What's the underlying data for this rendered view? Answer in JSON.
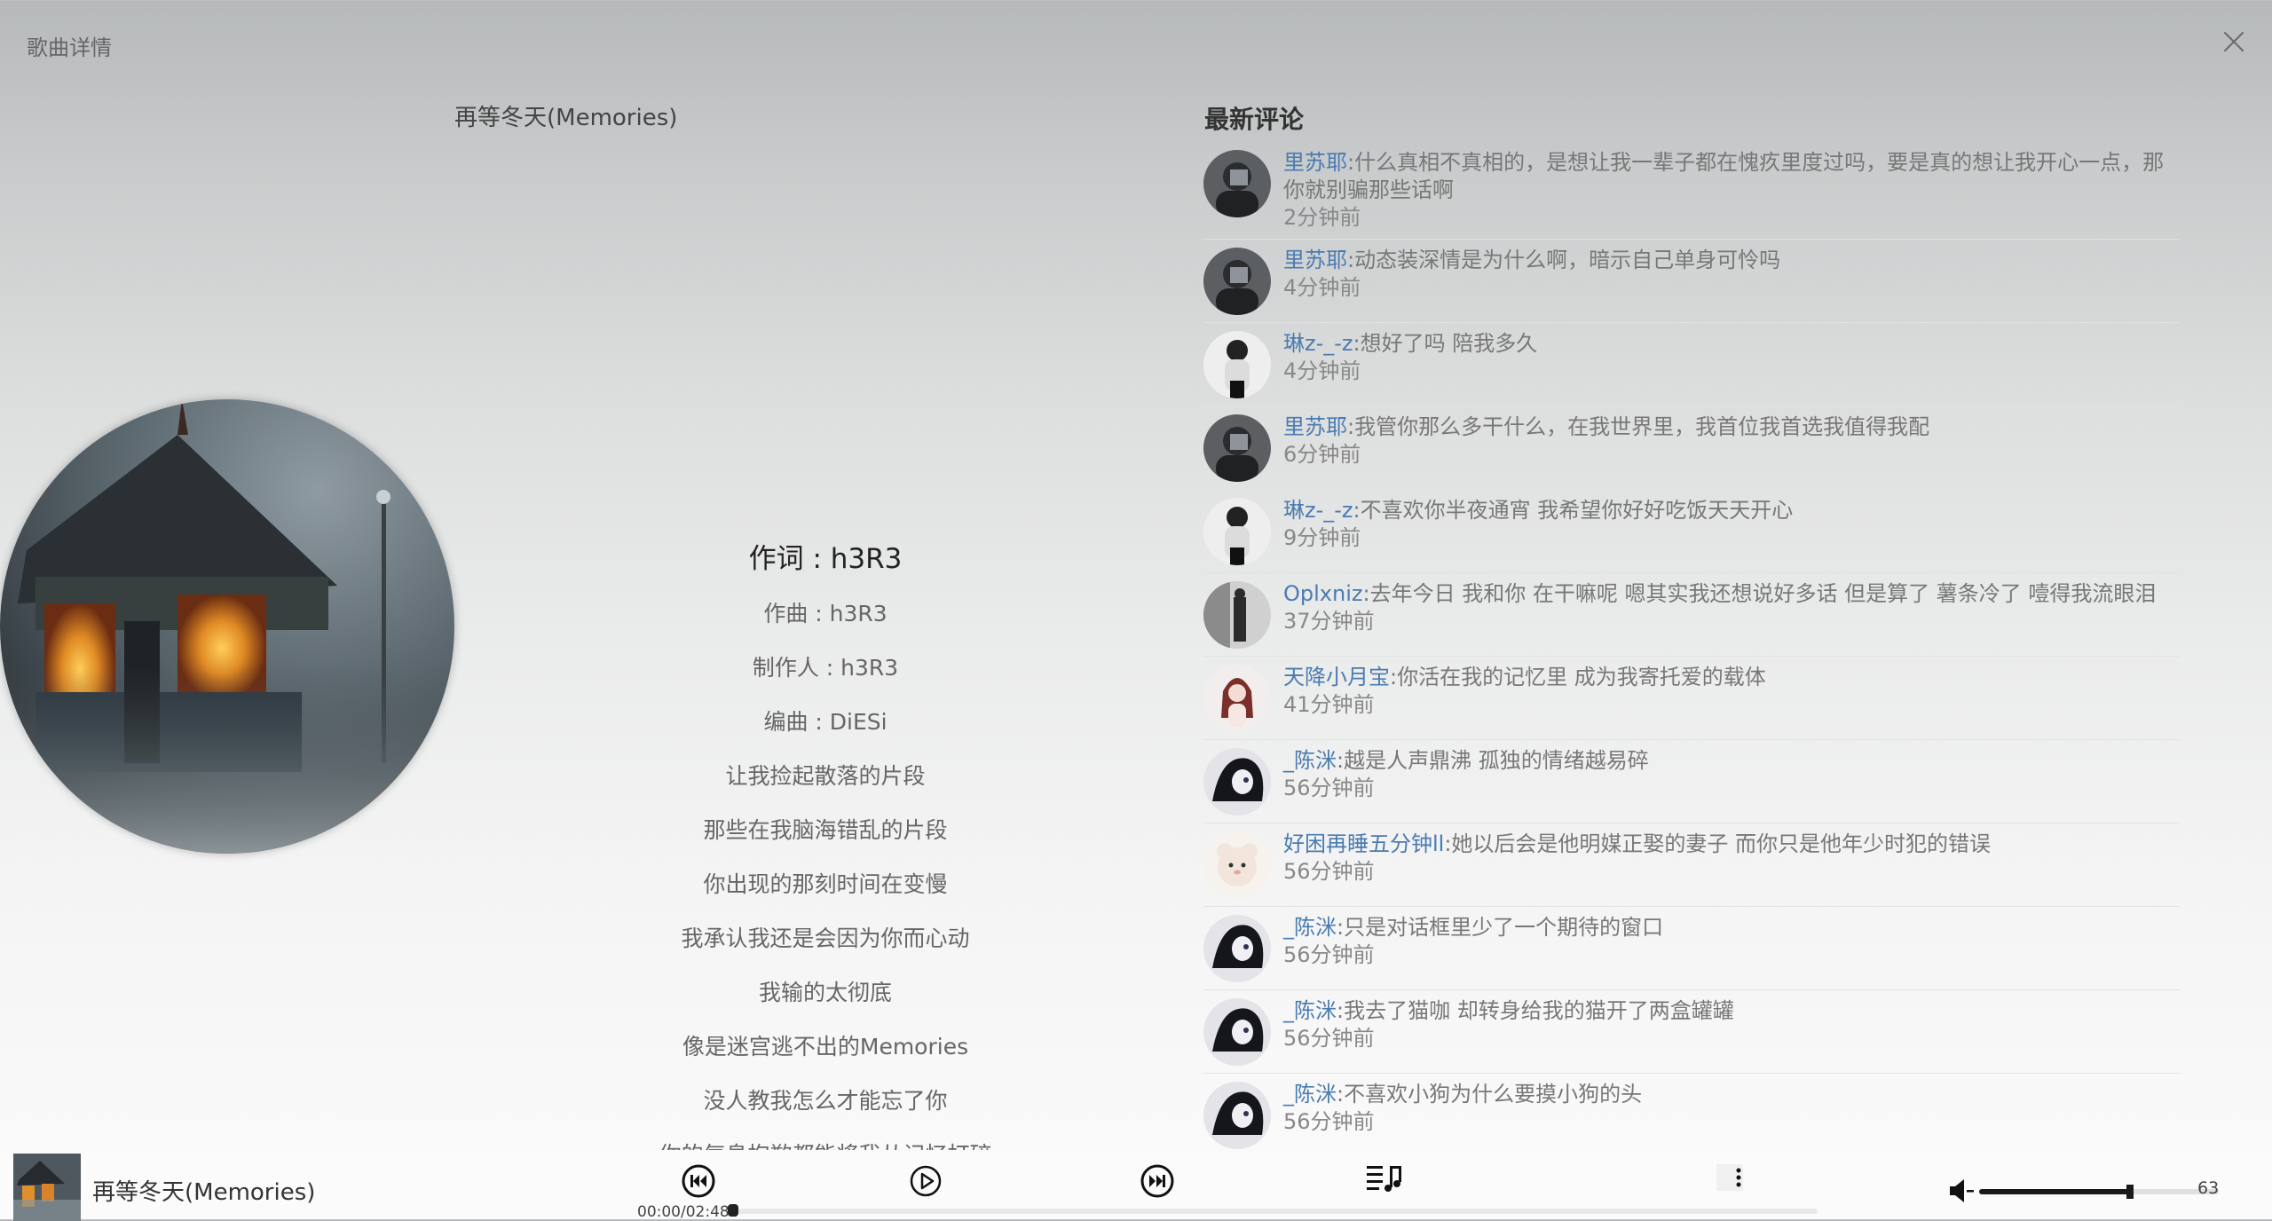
{
  "header": {
    "title": "歌曲详情",
    "close_icon": "close-icon"
  },
  "song": {
    "title": "再等冬天(Memories)"
  },
  "lyrics": [
    "作词 : h3R3",
    "作曲 : h3R3",
    "制作人 : h3R3",
    "编曲 : DiESi",
    "让我捡起散落的片段",
    "那些在我脑海错乱的片段",
    "你出现的那刻时间在变慢",
    "我承认我还是会因为你而心动",
    "我输的太彻底",
    "像是迷宫逃不出的Memories",
    "没人教我怎么才能忘了你",
    "你的气息抱歉都能将我从记忆打碎"
  ],
  "comments": {
    "heading": "最新评论",
    "items": [
      {
        "user": "里苏耶",
        "text": ":什么真相不真相的，是想让我一辈子都在愧疚里度过吗，要是真的想让我开心一点，那你就别骗那些话啊",
        "time": "2分钟前",
        "avatar": "a"
      },
      {
        "user": "里苏耶",
        "text": ":动态装深情是为什么啊，暗示自己单身可怜吗",
        "time": "4分钟前",
        "avatar": "a"
      },
      {
        "user": "琳z-_-z",
        "text": ":想好了吗 陪我多久",
        "time": "4分钟前",
        "avatar": "b"
      },
      {
        "user": "里苏耶",
        "text": ":我管你那么多干什么，在我世界里，我首位我首选我值得我配",
        "time": "6分钟前",
        "avatar": "a"
      },
      {
        "user": "琳z-_-z",
        "text": ":不喜欢你半夜通宵 我希望你好好吃饭天天开心",
        "time": "9分钟前",
        "avatar": "b"
      },
      {
        "user": "Oplxniz",
        "text": ":去年今日 我和你 在干嘛呢 嗯其实我还想说好多话 但是算了 薯条冷了 噎得我流眼泪",
        "time": "37分钟前",
        "avatar": "c"
      },
      {
        "user": "天降小月宝",
        "text": ":你活在我的记忆里 成为我寄托爱的载体",
        "time": "41分钟前",
        "avatar": "d"
      },
      {
        "user": "_陈洣",
        "text": ":越是人声鼎沸 孤独的情绪越易碎",
        "time": "56分钟前",
        "avatar": "e"
      },
      {
        "user": "好困再睡五分钟ll",
        "text": ":她以后会是他明媒正娶的妻子 而你只是他年少时犯的错误",
        "time": "56分钟前",
        "avatar": "f"
      },
      {
        "user": "_陈洣",
        "text": ":只是对话框里少了一个期待的窗口",
        "time": "56分钟前",
        "avatar": "e"
      },
      {
        "user": "_陈洣",
        "text": ":我去了猫咖 却转身给我的猫开了两盒罐罐",
        "time": "56分钟前",
        "avatar": "e"
      },
      {
        "user": "_陈洣",
        "text": ":不喜欢小狗为什么要摸小狗的头",
        "time": "56分钟前",
        "avatar": "e"
      }
    ]
  },
  "player": {
    "title": "再等冬天(Memories)",
    "time": "00:00/02:48",
    "progress": 0.0,
    "volume": 63,
    "volume_label": "63",
    "icons": [
      "prev-icon",
      "play-icon",
      "next-icon",
      "playlist-icon",
      "more-icon",
      "volume-icon"
    ]
  }
}
